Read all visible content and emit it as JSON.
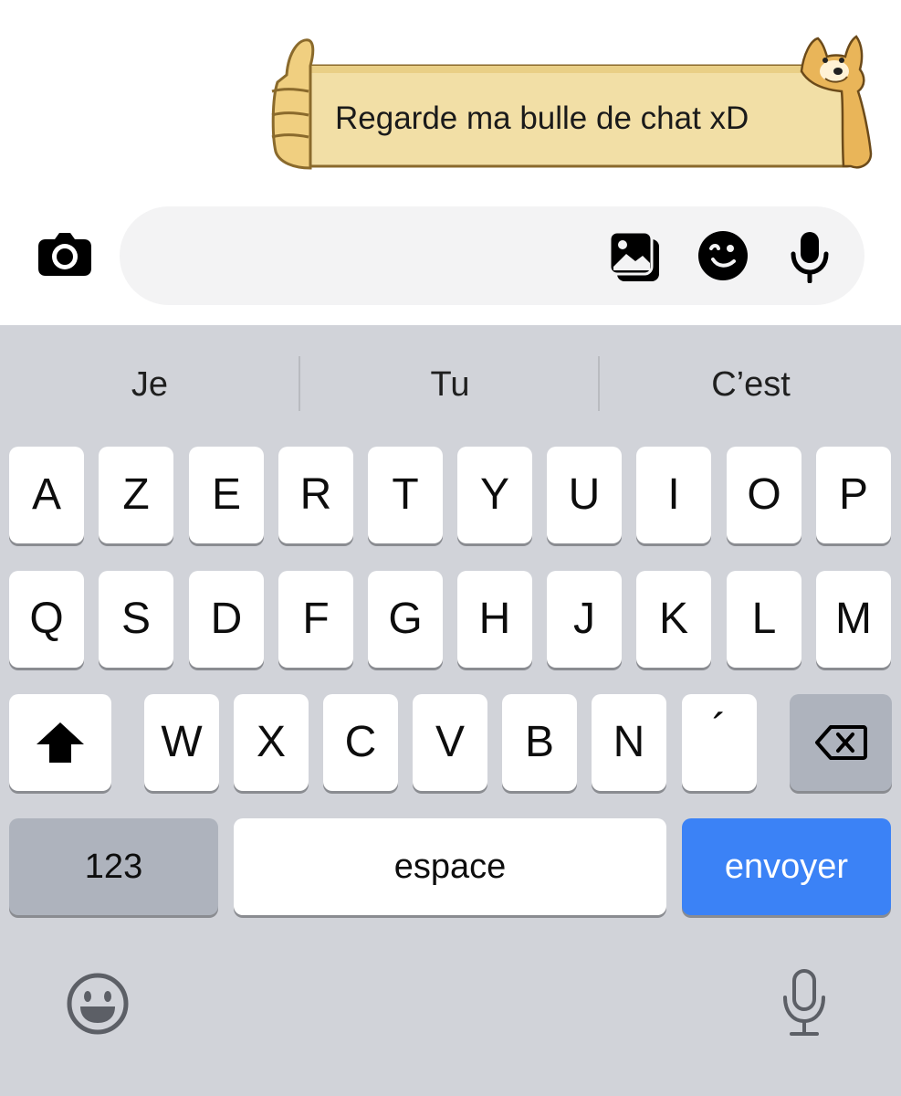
{
  "chat": {
    "message": "Regarde ma bulle de chat xD",
    "bubble_colors": {
      "fill": "#f2dfa6",
      "stroke": "#8a6a2c"
    }
  },
  "composer": {
    "icons": [
      "camera-icon",
      "gallery-icon",
      "sticker-icon",
      "microphone-icon"
    ]
  },
  "keyboard": {
    "suggestions": [
      "Je",
      "Tu",
      "C’est"
    ],
    "row1": [
      "A",
      "Z",
      "E",
      "R",
      "T",
      "Y",
      "U",
      "I",
      "O",
      "P"
    ],
    "row2": [
      "Q",
      "S",
      "D",
      "F",
      "G",
      "H",
      "J",
      "K",
      "L",
      "M"
    ],
    "row3": [
      "W",
      "X",
      "C",
      "V",
      "B",
      "N",
      "´"
    ],
    "numbers_label": "123",
    "space_label": "espace",
    "send_label": "envoyer",
    "colors": {
      "background": "#d1d3d9",
      "key": "#ffffff",
      "dark_key": "#aeb3bd",
      "send": "#3b82f6"
    }
  },
  "bottom_bar": {
    "icons": [
      "emoji-icon",
      "dictation-microphone-icon"
    ]
  }
}
